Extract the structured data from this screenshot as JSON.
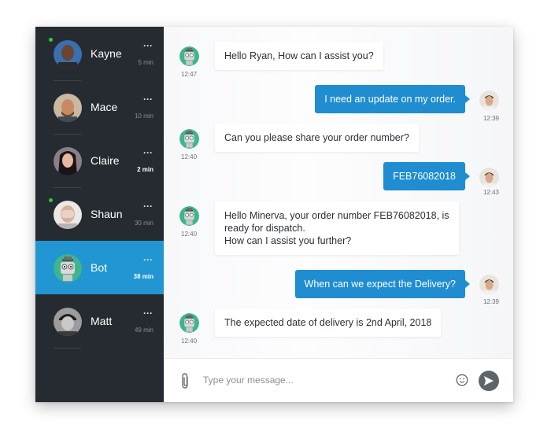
{
  "contacts": [
    {
      "name": "Kayne",
      "time": "5 min",
      "more": "···"
    },
    {
      "name": "Mace",
      "time": "10 min",
      "more": "···"
    },
    {
      "name": "Claire",
      "time": "2 min",
      "more": "···"
    },
    {
      "name": "Shaun",
      "time": "30 min",
      "more": "···"
    },
    {
      "name": "Bot",
      "time": "38 min",
      "more": "···"
    },
    {
      "name": "Matt",
      "time": "49 min",
      "more": "···"
    }
  ],
  "messages": [
    {
      "from": "bot",
      "text": "Hello Ryan, How can I assist you?",
      "time": "12:47"
    },
    {
      "from": "user",
      "text": "I need an update on my order.",
      "time": "12:39"
    },
    {
      "from": "bot",
      "text": "Can you please share your order number?",
      "time": "12:40"
    },
    {
      "from": "user",
      "text": "FEB76082018",
      "time": "12:43"
    },
    {
      "from": "bot",
      "text": "Hello Minerva, your order number FEB76082018, is\nready for dispatch.\nHow can I assist you further?",
      "time": "12:40"
    },
    {
      "from": "user",
      "text": "When can we expect the Delivery?",
      "time": "12:39"
    },
    {
      "from": "bot",
      "text": "The expected date of delivery is 2nd April, 2018",
      "time": "12:40"
    }
  ],
  "composer": {
    "placeholder": "Type your message..."
  },
  "colors": {
    "sidebar": "#262b31",
    "active": "#2196d3",
    "outgoing": "#1f8dd0",
    "online": "#2ecc40"
  }
}
